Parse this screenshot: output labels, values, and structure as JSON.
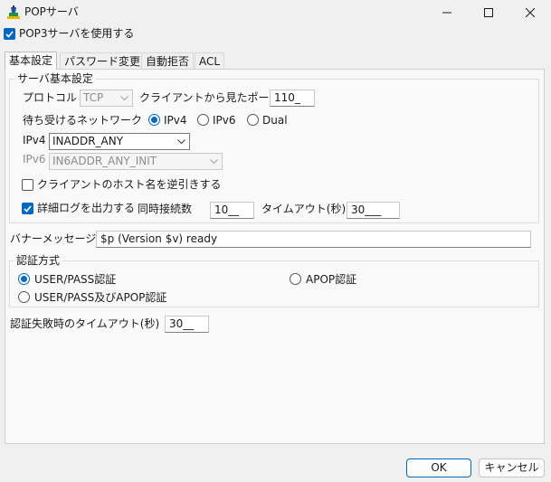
{
  "window": {
    "title": "POPサーバ"
  },
  "use_pop3": {
    "label": "POP3サーバを使用する",
    "checked": true
  },
  "tabs": [
    {
      "label": "基本設定"
    },
    {
      "label": "パスワード変更"
    },
    {
      "label": "自動拒否"
    },
    {
      "label": "ACL"
    }
  ],
  "server": {
    "group_title": "サーバ基本設定",
    "protocol_label": "プロトコル",
    "protocol_value": "TCP",
    "client_port_label": "クライアントから見たポート",
    "client_port_value": "110_",
    "network_label": "待ち受けるネットワーク",
    "network_options": [
      "IPv4",
      "IPv6",
      "Dual"
    ],
    "network_selected": "IPv4",
    "ipv4_label": "IPv4",
    "ipv4_value": "INADDR_ANY",
    "ipv6_label": "IPv6",
    "ipv6_value": "IN6ADDR_ANY_INIT",
    "reverse_lookup_label": "クライアントのホスト名を逆引きする",
    "reverse_lookup_checked": false,
    "detail_log_label": "詳細ログを出力する",
    "detail_log_checked": true,
    "concurrent_label": "同時接続数",
    "concurrent_value": "10__",
    "timeout_label": "タイムアウト(秒)",
    "timeout_value": "30___"
  },
  "banner": {
    "label": "バナーメッセージ",
    "value": "$p (Version $v) ready"
  },
  "auth": {
    "group_title": "認証方式",
    "options": [
      "USER/PASS認証",
      "APOP認証",
      "USER/PASS及びAPOP認証"
    ],
    "selected": "USER/PASS認証"
  },
  "auth_fail_timeout": {
    "label": "認証失敗時のタイムアウト(秒)",
    "value": "30__"
  },
  "buttons": {
    "ok": "OK",
    "cancel": "キャンセル"
  },
  "colors": {
    "accent": "#0067c0",
    "background": "#f0f0f0",
    "panel": "#f9f9f9"
  }
}
